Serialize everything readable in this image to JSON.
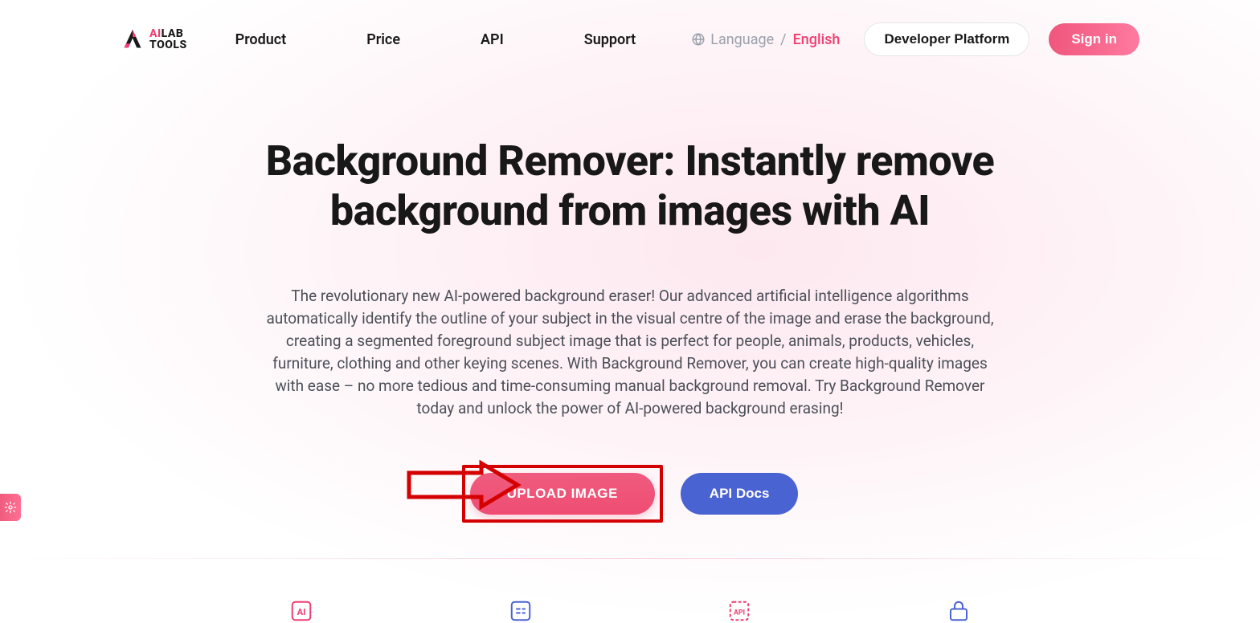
{
  "logo": {
    "brand_prefix": "AI",
    "brand_line1_rest": "LAB",
    "brand_line2": "TOOLS"
  },
  "nav": {
    "product": "Product",
    "price": "Price",
    "api": "API",
    "support": "Support"
  },
  "lang": {
    "label": "Language",
    "sep": "/",
    "value": "English"
  },
  "buttons": {
    "developer": "Developer Platform",
    "signin": "Sign in"
  },
  "hero": {
    "title": "Background Remover: Instantly remove background from images with AI",
    "description": "The revolutionary new AI-powered background eraser! Our advanced artificial intelligence algorithms automatically identify the outline of your subject in the visual centre of the image and erase the background, creating a segmented foreground subject image that is perfect for people, animals, products, vehicles, furniture, clothing and other keying scenes. With Background Remover, you can create high-quality images with ease – no more tedious and time-consuming manual background removal. Try Background Remover today and unlock the power of AI-powered background erasing!"
  },
  "cta": {
    "upload": "UPLOAD IMAGE",
    "api_docs": "API Docs"
  }
}
